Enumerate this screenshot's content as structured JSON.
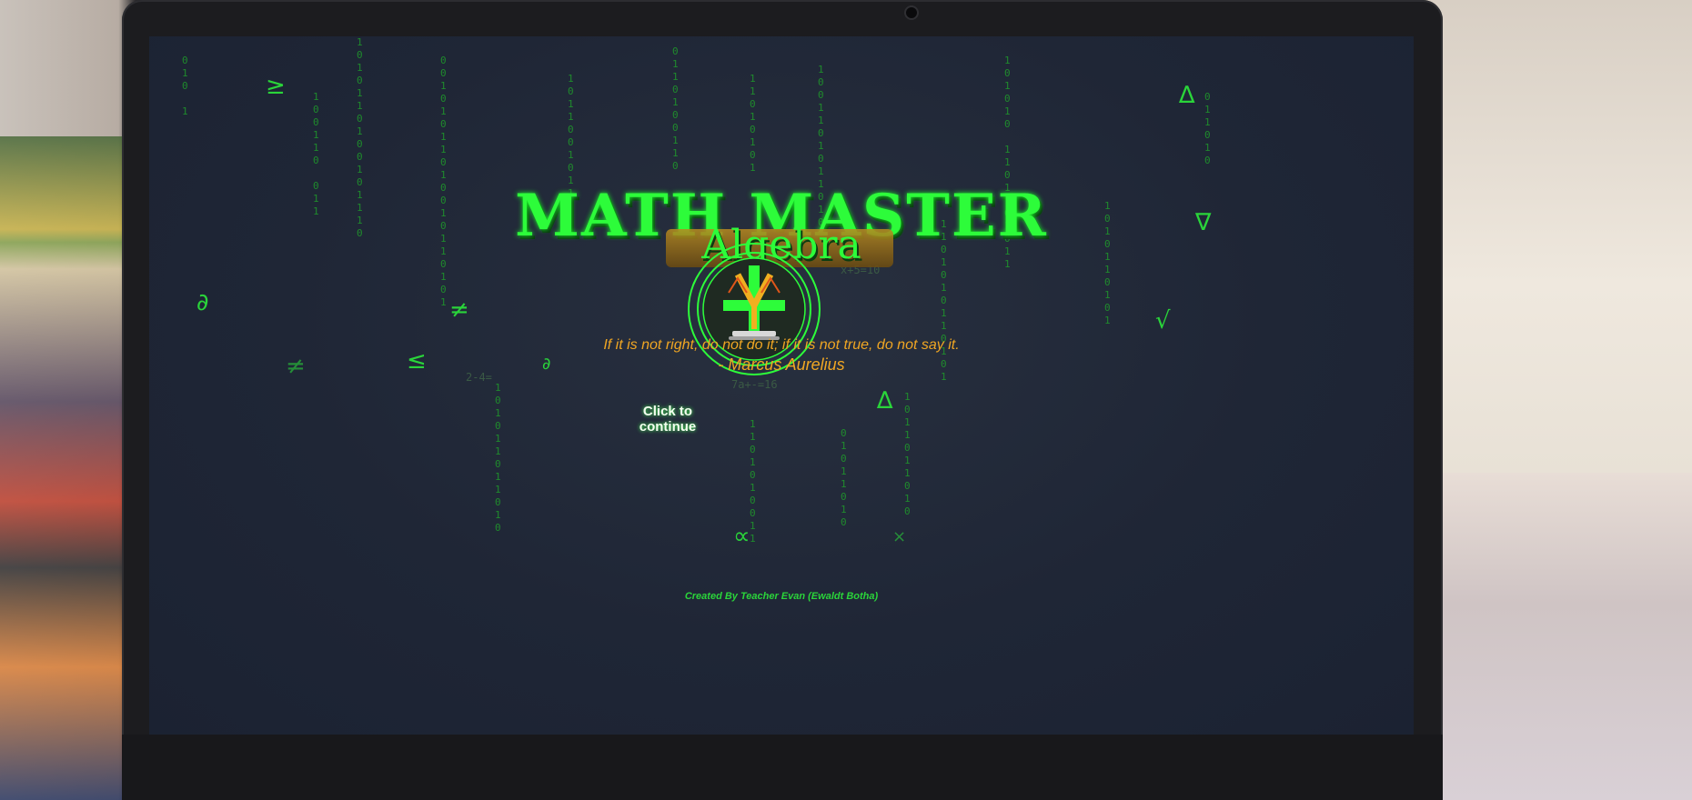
{
  "app": {
    "title": "MATH MASTER",
    "subtitle": "Algebra",
    "logo_icon": "balance-scale-icon"
  },
  "quote": {
    "text": "If it is not right, do not do it; if it is not true, do not say it.",
    "author": "- Marcus Aurelius"
  },
  "actions": {
    "continue_label": "Click to continue"
  },
  "footer": {
    "credit": "Created By Teacher Evan (Ewaldt Botha)"
  },
  "background": {
    "floating_symbols": [
      "≥",
      "∆",
      "∇",
      "∂",
      "≠",
      "∂",
      "√",
      "≤",
      "≠",
      "∂",
      "∆",
      "∝",
      "×"
    ],
    "faint_equations": [
      "x+5=10",
      "2-4=",
      "7a+-=16"
    ]
  },
  "colors": {
    "accent_green": "#2dfc3a",
    "quote_orange": "#f0a623",
    "screen_bg": "#1f2636"
  }
}
